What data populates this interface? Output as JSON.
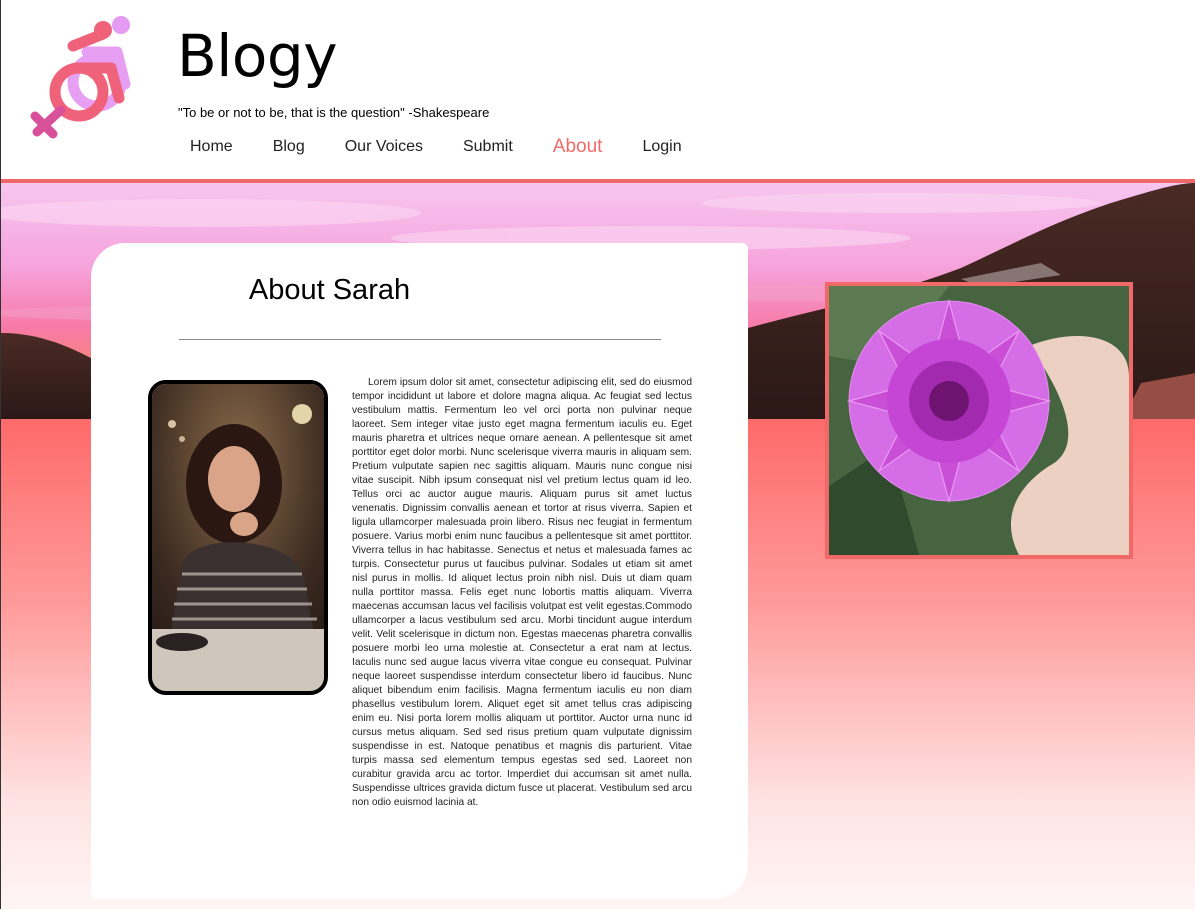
{
  "site": {
    "title": "Blogy",
    "tagline": "\"To be or not to be, that is the question\" -Shakespeare",
    "logo_icon": "accessibility-female-symbol-icon"
  },
  "nav": {
    "items": [
      {
        "label": "Home",
        "active": false
      },
      {
        "label": "Blog",
        "active": false
      },
      {
        "label": "Our Voices",
        "active": false
      },
      {
        "label": "Submit",
        "active": false
      },
      {
        "label": "About",
        "active": true
      },
      {
        "label": "Login",
        "active": false
      }
    ]
  },
  "about": {
    "title": "About Sarah",
    "bio": "Lorem ipsum dolor sit amet, consectetur adipiscing elit, sed do eiusmod tempor incididunt ut labore et dolore magna aliqua. Ac feugiat sed lectus vestibulum mattis. Fermentum leo vel orci porta non pulvinar neque laoreet. Sem integer vitae justo eget magna fermentum iaculis eu. Eget mauris pharetra et ultrices neque ornare aenean. A pellentesque sit amet porttitor eget dolor morbi. Nunc scelerisque viverra mauris in aliquam sem. Pretium vulputate sapien nec sagittis aliquam. Mauris nunc congue nisi vitae suscipit. Nibh ipsum consequat nisl vel pretium lectus quam id leo. Tellus orci ac auctor augue mauris. Aliquam purus sit amet luctus venenatis. Dignissim convallis aenean et tortor at risus viverra. Sapien et ligula ullamcorper malesuada proin libero. Risus nec feugiat in fermentum posuere. Varius morbi enim nunc faucibus a pellentesque sit amet porttitor. Viverra tellus in hac habitasse. Senectus et netus et malesuada fames ac turpis. Consectetur purus ut faucibus pulvinar. Sodales ut etiam sit amet nisl purus in mollis. Id aliquet lectus proin nibh nisl. Duis ut diam quam nulla porttitor massa. Felis eget nunc lobortis mattis aliquam. Viverra maecenas accumsan lacus vel facilisis volutpat est velit egestas.Commodo ullamcorper a lacus vestibulum sed arcu. Morbi tincidunt augue interdum velit. Velit scelerisque in dictum non. Egestas maecenas pharetra convallis posuere morbi leo urna molestie at. Consectetur a erat nam at lectus. Iaculis nunc sed augue lacus viverra vitae congue eu consequat. Pulvinar neque laoreet suspendisse interdum consectetur libero id faucibus. Nunc aliquet bibendum enim facilisis. Magna fermentum iaculis eu non diam phasellus vestibulum lorem. Aliquet eget sit amet tellus cras adipiscing enim eu. Nisi porta lorem mollis aliquam ut porttitor. Auctor urna nunc id cursus metus aliquam. Sed sed risus pretium quam vulputate dignissim suspendisse in est. Natoque penatibus et magnis dis parturient. Vitae turpis massa sed elementum tempus egestas sed sed. Laoreet non curabitur gravida arcu ac tortor. Imperdiet dui accumsan sit amet nulla. Suspendisse ultrices gravida dictum fusce ut placerat. Vestibulum sed arcu non odio euismod lacinia at."
  },
  "colors": {
    "accent": "#f06868",
    "background_pink": "#fe6b6b"
  }
}
